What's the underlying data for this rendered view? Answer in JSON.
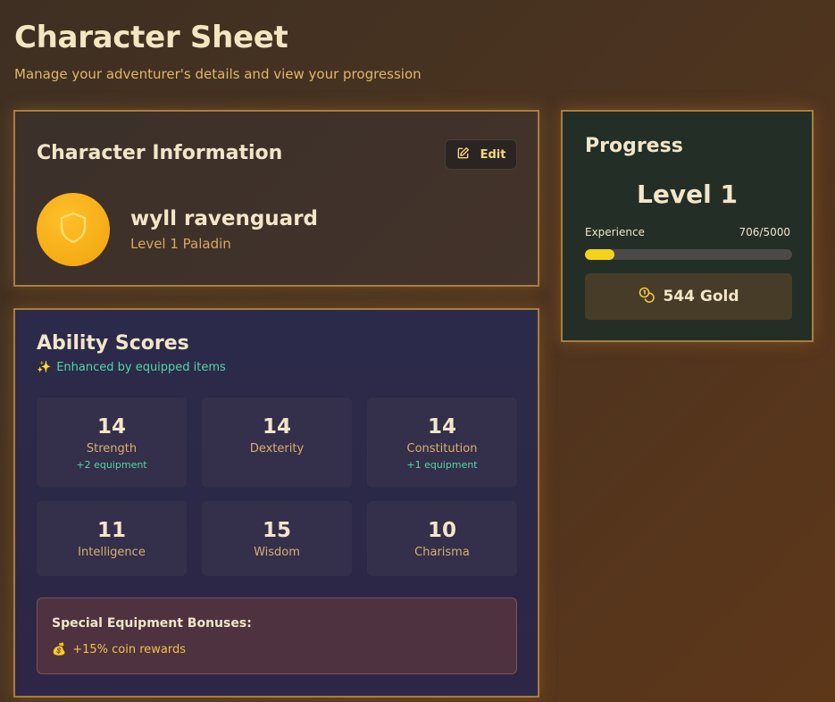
{
  "header": {
    "title": "Character Sheet",
    "subtitle": "Manage your adventurer's details and view your progression"
  },
  "character_info": {
    "title": "Character Information",
    "edit_label": "Edit",
    "name": "wyll ravenguard",
    "class_line": "Level 1 Paladin",
    "avatar_icon": "shield-icon"
  },
  "progress": {
    "title": "Progress",
    "level_label": "Level 1",
    "experience_label": "Experience",
    "experience_value": "706/5000",
    "experience_current": 706,
    "experience_max": 5000,
    "gold_label": "544 Gold",
    "gold_icon": "coins-icon"
  },
  "abilities": {
    "title": "Ability Scores",
    "enhanced_note": "Enhanced by equipped items",
    "enhanced_icon": "sparkles-icon",
    "stats": [
      {
        "value": "14",
        "name": "Strength",
        "bonus": "+2 equipment"
      },
      {
        "value": "14",
        "name": "Dexterity",
        "bonus": ""
      },
      {
        "value": "14",
        "name": "Constitution",
        "bonus": "+1 equipment"
      },
      {
        "value": "11",
        "name": "Intelligence",
        "bonus": ""
      },
      {
        "value": "15",
        "name": "Wisdom",
        "bonus": ""
      },
      {
        "value": "10",
        "name": "Charisma",
        "bonus": ""
      }
    ],
    "special": {
      "title": "Special Equipment Bonuses:",
      "items": [
        {
          "icon": "money-bag-icon",
          "text": "+15% coin rewards"
        }
      ]
    }
  },
  "colors": {
    "accent_gold": "#f5d31b",
    "border_gold": "#a97d3d",
    "bonus_green": "#55d7a2"
  }
}
